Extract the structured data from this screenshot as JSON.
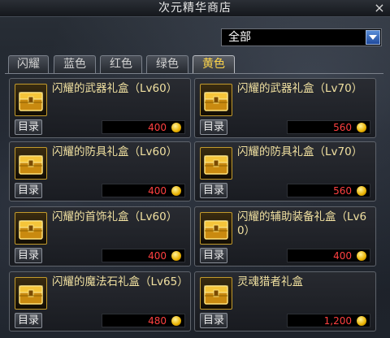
{
  "window": {
    "title": "次元精华商店",
    "close_icon": "×"
  },
  "filter": {
    "selected": "全部"
  },
  "tabs": [
    {
      "label": "闪耀"
    },
    {
      "label": "蓝色"
    },
    {
      "label": "红色"
    },
    {
      "label": "绿色"
    },
    {
      "label": "黄色",
      "active": true
    }
  ],
  "catalog_button_label": "目录",
  "items": [
    {
      "name": "闪耀的武器礼盒（Lv60）",
      "price": "400",
      "currency_icon": "gold-coin-icon"
    },
    {
      "name": "闪耀的武器礼盒（Lv70）",
      "price": "560",
      "currency_icon": "gold-coin-icon"
    },
    {
      "name": "闪耀的防具礼盒（Lv60）",
      "price": "400",
      "currency_icon": "gold-coin-icon"
    },
    {
      "name": "闪耀的防具礼盒（Lv70）",
      "price": "560",
      "currency_icon": "gold-coin-icon"
    },
    {
      "name": "闪耀的首饰礼盒（Lv60）",
      "price": "400",
      "currency_icon": "gold-coin-icon"
    },
    {
      "name": "闪耀的辅助装备礼盒（Lv60）",
      "price": "400",
      "currency_icon": "gold-coin-icon"
    },
    {
      "name": "闪耀的魔法石礼盒（Lv65）",
      "price": "480",
      "currency_icon": "gold-coin-icon"
    },
    {
      "name": "灵魂猎者礼盒",
      "price": "1,200",
      "currency_icon": "gold-coin-icon"
    }
  ],
  "colors": {
    "accent": "#ffd64a",
    "price": "#ff4040",
    "item_name": "#f0e0a0"
  }
}
